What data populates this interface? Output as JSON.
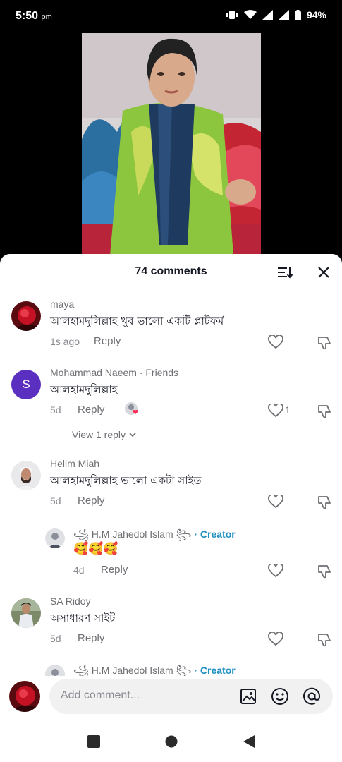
{
  "status": {
    "time": "5:50",
    "ampm": "pm",
    "battery": "94%"
  },
  "sheet": {
    "title": "74 comments"
  },
  "comments": [
    {
      "name": "maya",
      "text": "আলহামদুলিল্লাহ খুব ভালো একটি প্লাটফর্ম",
      "time": "1s ago",
      "reply": "Reply"
    },
    {
      "name": "Mohammad Naeem · Friends",
      "avatar_letter": "S",
      "text": "আলহামদুলিল্লাহ",
      "time": "5d",
      "reply": "Reply",
      "likes": "1"
    },
    {
      "name": "Helim Miah",
      "text": "আলহামদুলিল্লাহ ভালো একটা সাইড",
      "time": "5d",
      "reply": "Reply"
    },
    {
      "name": "H.M Jahedol Islam",
      "creator_tag": "· Creator",
      "text": "🥰🥰🥰",
      "time": "4d",
      "reply": "Reply"
    },
    {
      "name": "SA Ridoy",
      "text": "অসাধারণ সাইট",
      "time": "5d",
      "reply": "Reply"
    },
    {
      "name": "H.M Jahedol Islam",
      "creator_tag": "· Creator"
    }
  ],
  "view_replies": "View 1 reply",
  "input": {
    "placeholder": "Add comment..."
  },
  "icons": [
    "sort-icon",
    "close-icon",
    "heart-icon",
    "dislike-icon",
    "image-icon",
    "emoji-icon",
    "mention-icon"
  ],
  "colors": {
    "accent": "#1f8fc1",
    "avatar_purple": "#5b2fbf"
  }
}
